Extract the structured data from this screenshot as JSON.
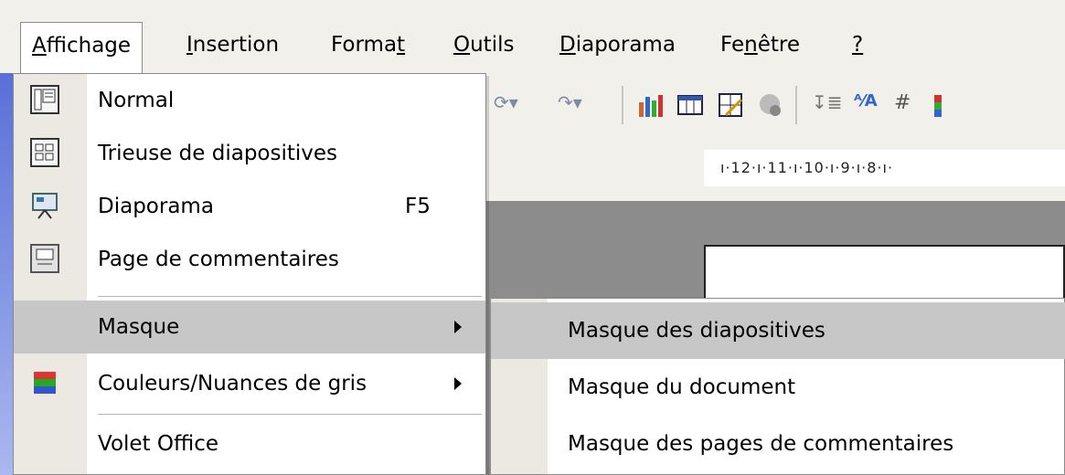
{
  "menubar": {
    "items": [
      {
        "label": "Affichage",
        "mnemonic": "A"
      },
      {
        "label": "Insertion",
        "mnemonic": "I"
      },
      {
        "label": "Format",
        "mnemonic": "t"
      },
      {
        "label": "Outils",
        "mnemonic": "O"
      },
      {
        "label": "Diaporama",
        "mnemonic": "D"
      },
      {
        "label": "Fenêtre",
        "mnemonic": "n"
      },
      {
        "label": "?",
        "mnemonic": "?"
      }
    ]
  },
  "ruler": {
    "text": "ı·12·ı·11·ı·10·ı·9·ı·8·ı·"
  },
  "affichage_menu": {
    "items": [
      {
        "label": "Normal",
        "icon": "normal-view-icon"
      },
      {
        "label": "Trieuse de diapositives",
        "icon": "slide-sorter-icon"
      },
      {
        "label": "Diaporama",
        "shortcut": "F5",
        "icon": "slideshow-icon"
      },
      {
        "label": "Page de commentaires",
        "icon": "notes-page-icon"
      },
      {
        "label": "Masque",
        "submenu": true,
        "highlighted": true
      },
      {
        "label": "Couleurs/Nuances de gris",
        "submenu": true,
        "icon": "color-grayscale-icon"
      },
      {
        "label": "Volet Office"
      }
    ]
  },
  "masque_submenu": {
    "items": [
      {
        "label": "Masque des diapositives",
        "highlighted": true
      },
      {
        "label": "Masque du document"
      },
      {
        "label": "Masque des pages de commentaires"
      }
    ]
  },
  "colors": {
    "menu_bg": "#f2f0eb",
    "gutter": "#ebe9e2",
    "highlight": "#c7c7c7",
    "workspace": "#8c8c8c"
  }
}
